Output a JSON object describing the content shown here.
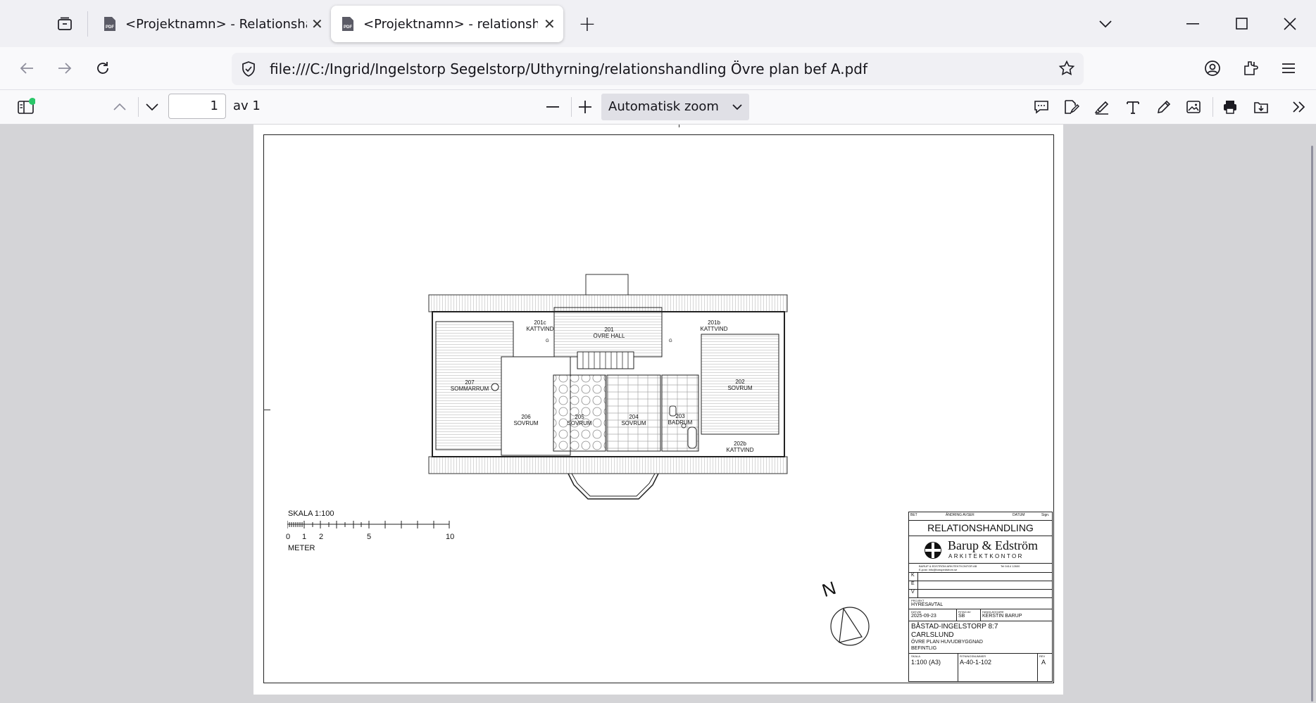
{
  "browser": {
    "tabs": [
      {
        "title": "<Projektnamn> - Relationshandling",
        "active": false,
        "favicon": "pdf-icon"
      },
      {
        "title": "<Projektnamn> - relationshandling",
        "active": true,
        "favicon": "pdf-icon"
      }
    ],
    "url": "file:///C:/Ingrid/Ingelstorp Segelstorp/Uthyrning/relationshandling Övre plan bef A.pdf"
  },
  "pdf_toolbar": {
    "page_number": "1",
    "page_total": "av 1",
    "zoom": "Automatisk zoom"
  },
  "drawing": {
    "rooms": [
      {
        "number": "201",
        "name": "ÖVRE HALL"
      },
      {
        "number": "201b",
        "name": "KATTVIND"
      },
      {
        "number": "201c",
        "name": "KATTVIND"
      },
      {
        "number": "202",
        "name": "SOVRUM"
      },
      {
        "number": "202b",
        "name": "KATTVIND"
      },
      {
        "number": "203",
        "name": "BADRUM"
      },
      {
        "number": "204",
        "name": "SOVRUM"
      },
      {
        "number": "205",
        "name": "SOVRUM"
      },
      {
        "number": "206",
        "name": "SOVRUM"
      },
      {
        "number": "207",
        "name": "SOMMARRUM"
      }
    ],
    "closet_mark": "G",
    "scale": {
      "label": "SKALA 1:100",
      "ticks": [
        "0",
        "1",
        "2",
        "5",
        "10"
      ],
      "unit": "METER"
    },
    "north": "N"
  },
  "title_block": {
    "rev_header": {
      "bet": "BET",
      "andring": "ÄNDRING AVSER",
      "datum": "DATUM",
      "sign": "Sign."
    },
    "doc_type": "RELATIONSHANDLING",
    "firm": "Barup & Edström",
    "firm_sub": "ARKITEKTKONTOR",
    "firm_contact_a": "BARUP & EDSTRÖM ARKITEKTKONTOR AB",
    "firm_contact_b": "Tel 0414 12600",
    "firm_contact_c": "E-post: info@barupedstrom.se",
    "rows": [
      "K",
      "E",
      "V"
    ],
    "projekt_label": "PROJEKT",
    "projekt": "HYRESAVTAL",
    "datum_label": "DATUM",
    "datum": "2025-09-23",
    "ritad_label": "RITAD AV",
    "ritad": "SB",
    "handl_label": "HANDLÄGGARE",
    "handl": "KERSTIN BARUP",
    "title1": "BÅSTAD-INGELSTORP 8:7",
    "title2": "CARLSLUND",
    "title3": "ÖVRE PLAN HUVUDBYGGNAD",
    "title4": "BEFINTLIG",
    "skala_label": "SKALA",
    "skala": "1:100 (A3)",
    "ritnr_label": "RITNINGSNUMMER",
    "ritnr": "A-40-1-102",
    "rev_label": "REV",
    "rev": "A"
  }
}
